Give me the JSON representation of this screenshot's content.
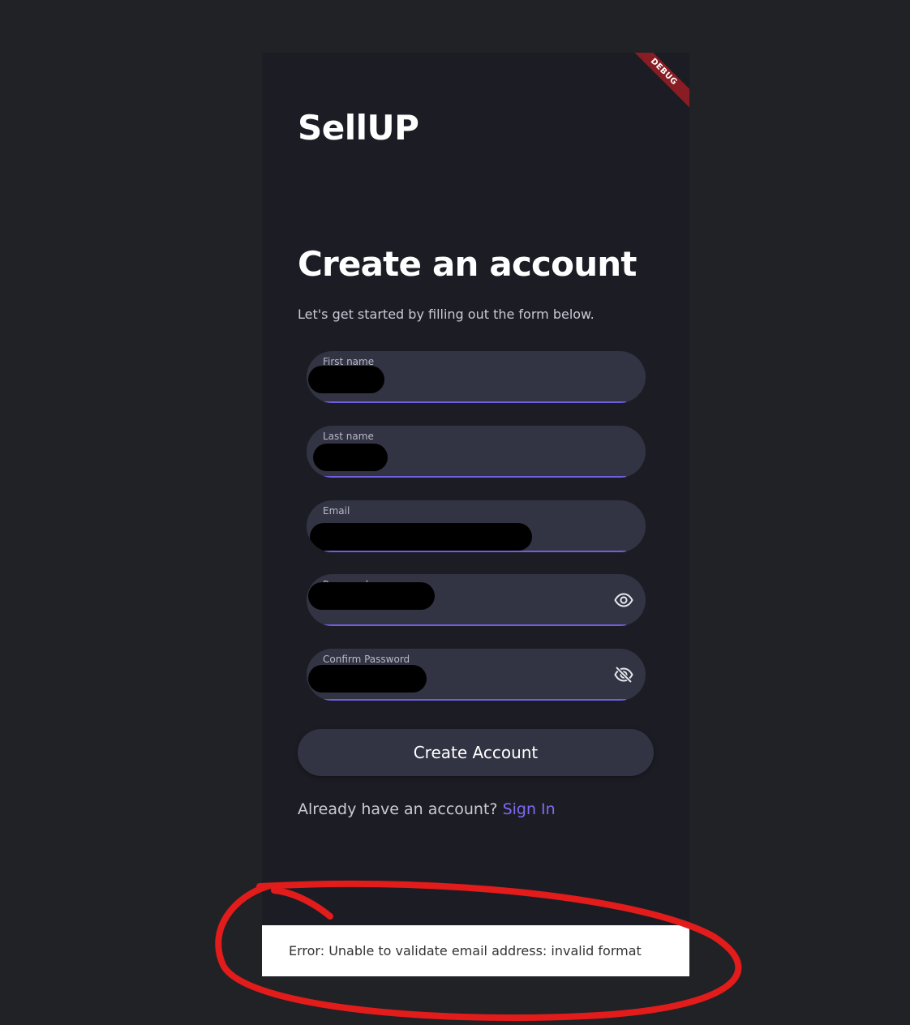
{
  "app": {
    "brand": "SellUP",
    "debug_banner": "DEBUG"
  },
  "form": {
    "title": "Create an account",
    "subtitle": "Let's get started by filling out the form below.",
    "fields": [
      {
        "label": "First name",
        "value": "",
        "redacted": true
      },
      {
        "label": "Last name",
        "value": "",
        "redacted": true
      },
      {
        "label": "Email",
        "value": "",
        "redacted": true
      },
      {
        "label": "Password",
        "value": "",
        "redacted": true,
        "icon": "eye-icon"
      },
      {
        "label": "Confirm Password",
        "value": "",
        "redacted": true,
        "icon": "eye-off-icon"
      }
    ],
    "submit_label": "Create Account",
    "signin_prompt": "Already have an account?",
    "signin_link": "Sign In"
  },
  "snackbar": {
    "message": "Error: Unable to validate email address: invalid format"
  },
  "colors": {
    "page_bg": "#212226",
    "app_bg": "#1c1d24",
    "field_bg": "#333443",
    "accent": "#7d6cf1",
    "annotation": "#e21b1b"
  }
}
